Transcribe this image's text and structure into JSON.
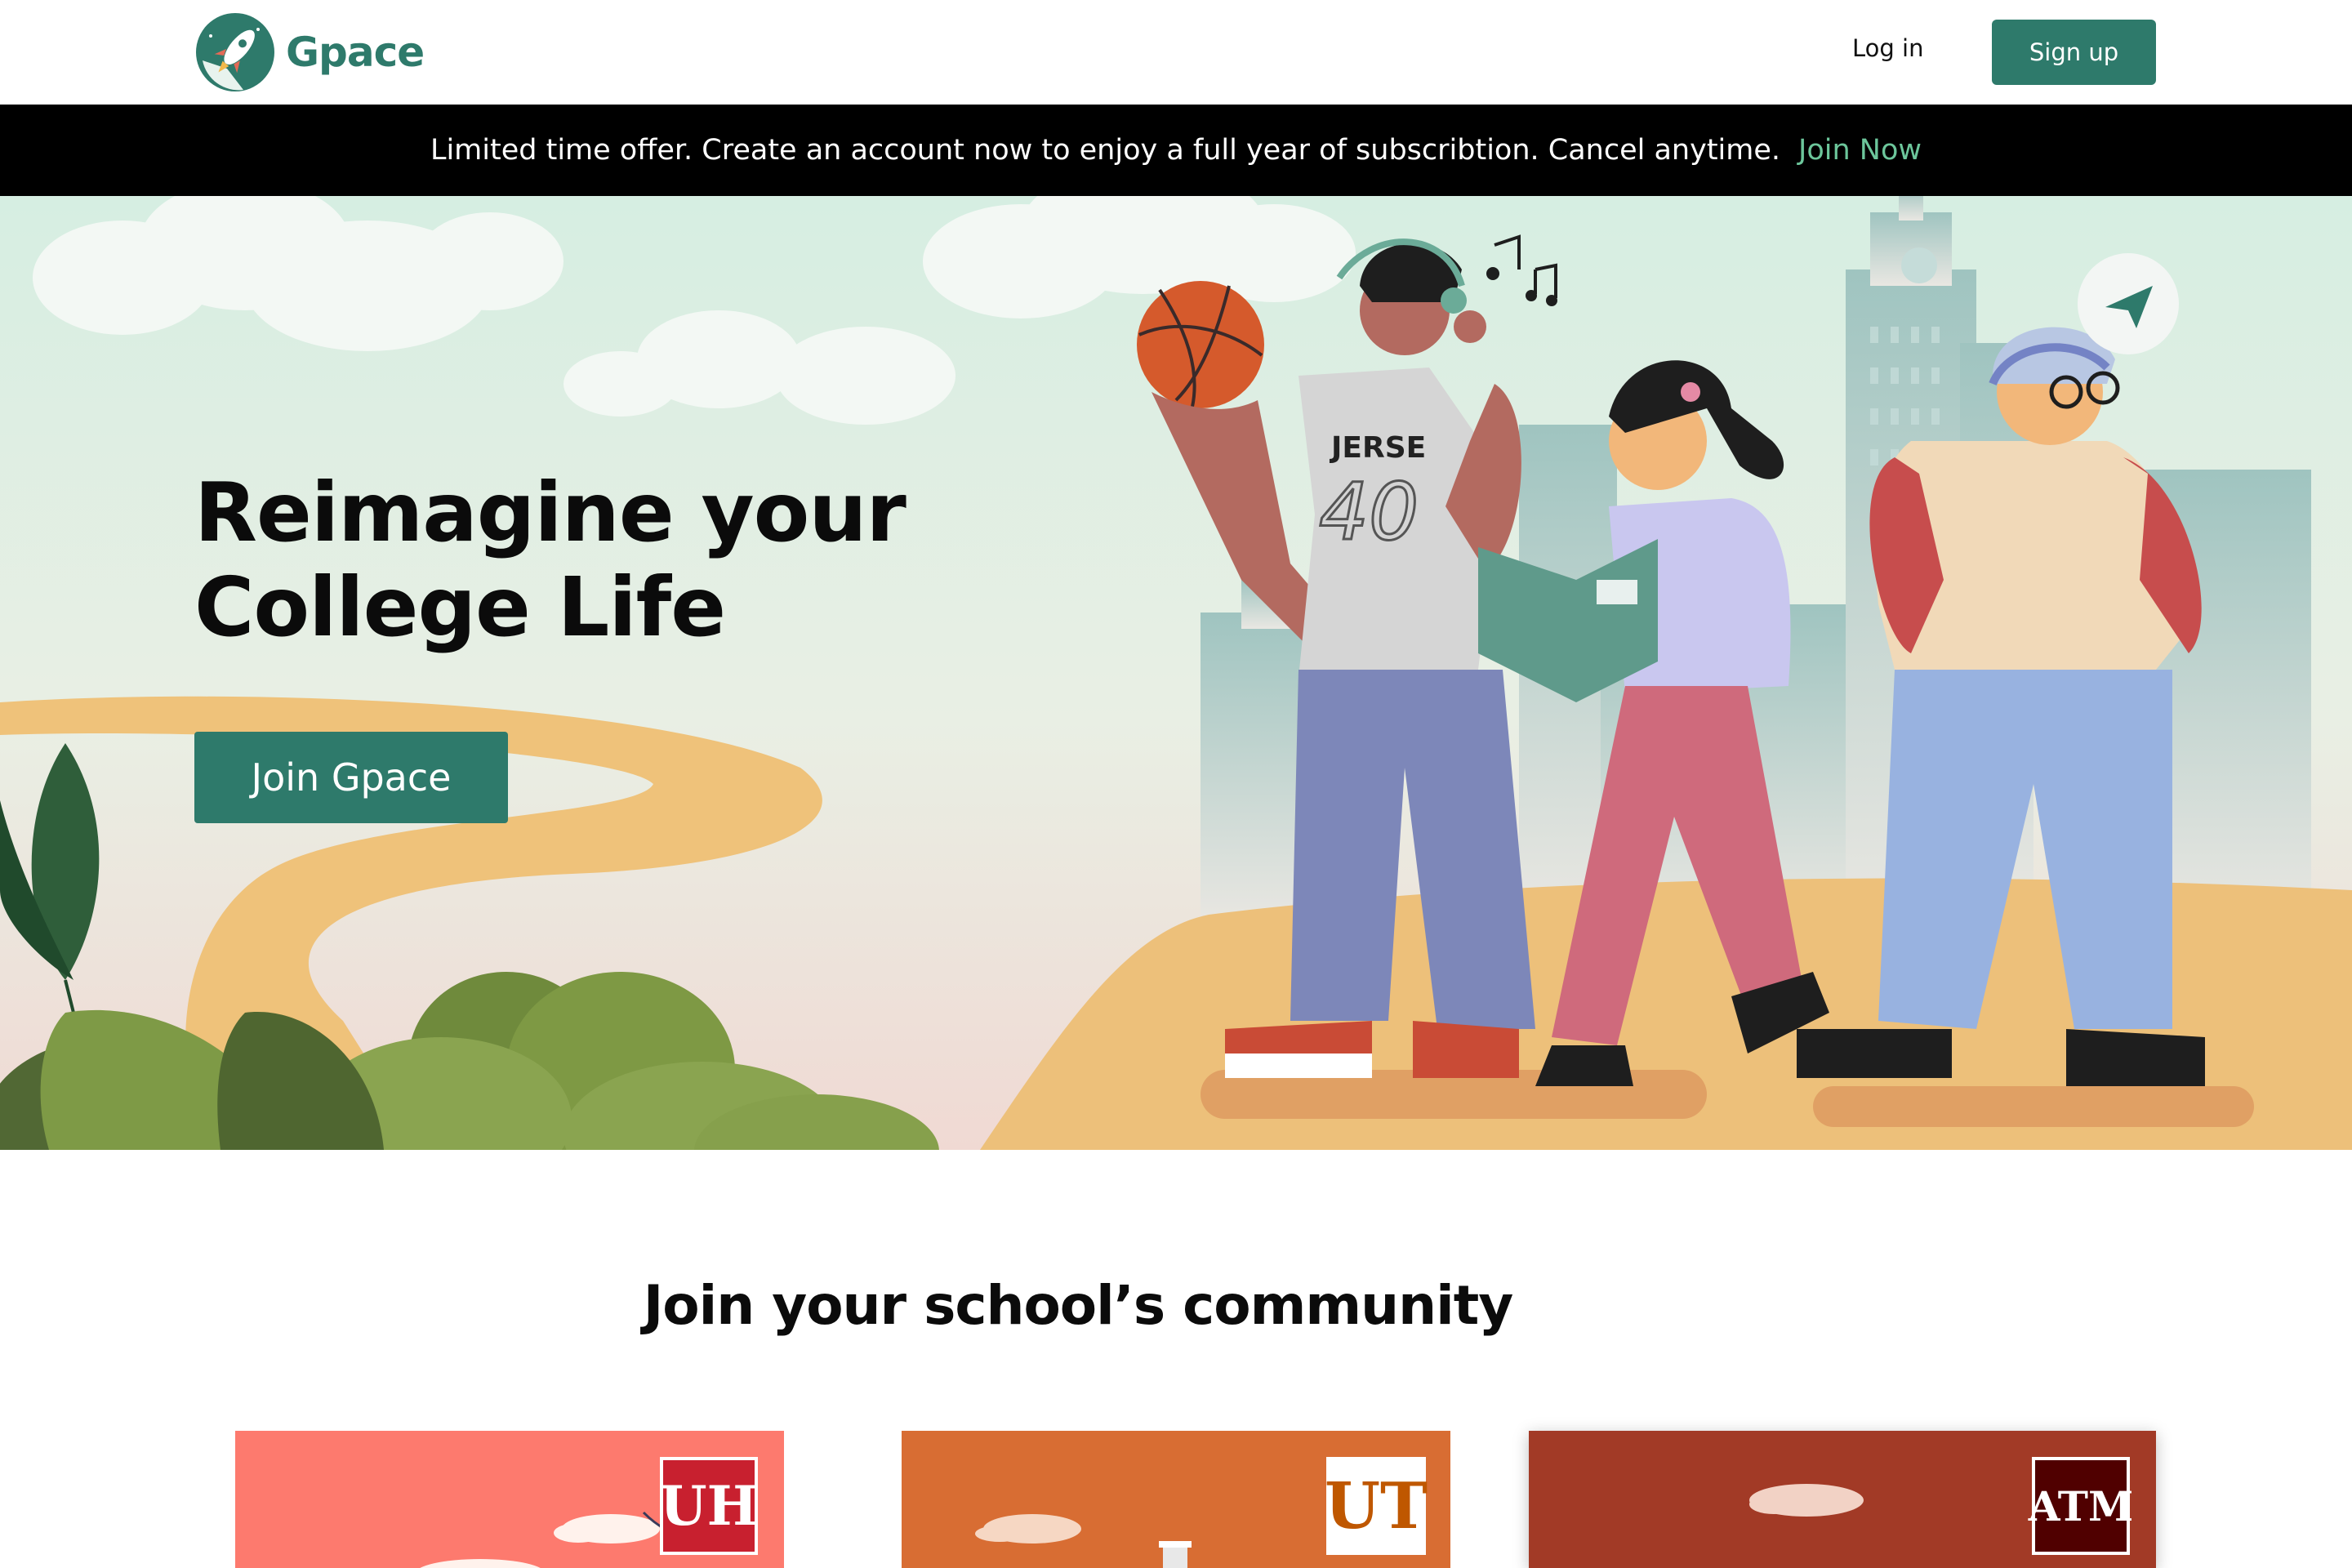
{
  "header": {
    "logo_text": "Gpace",
    "login_label": "Log in",
    "signup_label": "Sign up"
  },
  "banner": {
    "message": "Limited time offer. Create an account now to enjoy a full year of subscribtion. Cancel anytime.",
    "link_label": "Join Now"
  },
  "hero": {
    "title_line1": "Reimagine your",
    "title_line2": "College Life",
    "cta_label": "Join Gpace",
    "jersey_text": "JERSE",
    "jersey_number": "40"
  },
  "community": {
    "title": "Join your school’s community",
    "schools": [
      {
        "logo_text": "UH",
        "color": "#fd7a6e"
      },
      {
        "logo_text": "UT",
        "color": "#d86d33"
      },
      {
        "logo_text": "ATM",
        "color": "#a23a26"
      }
    ]
  },
  "colors": {
    "brand": "#2e7a6b",
    "banner_bg": "#000000",
    "banner_link": "#6cc69b"
  }
}
